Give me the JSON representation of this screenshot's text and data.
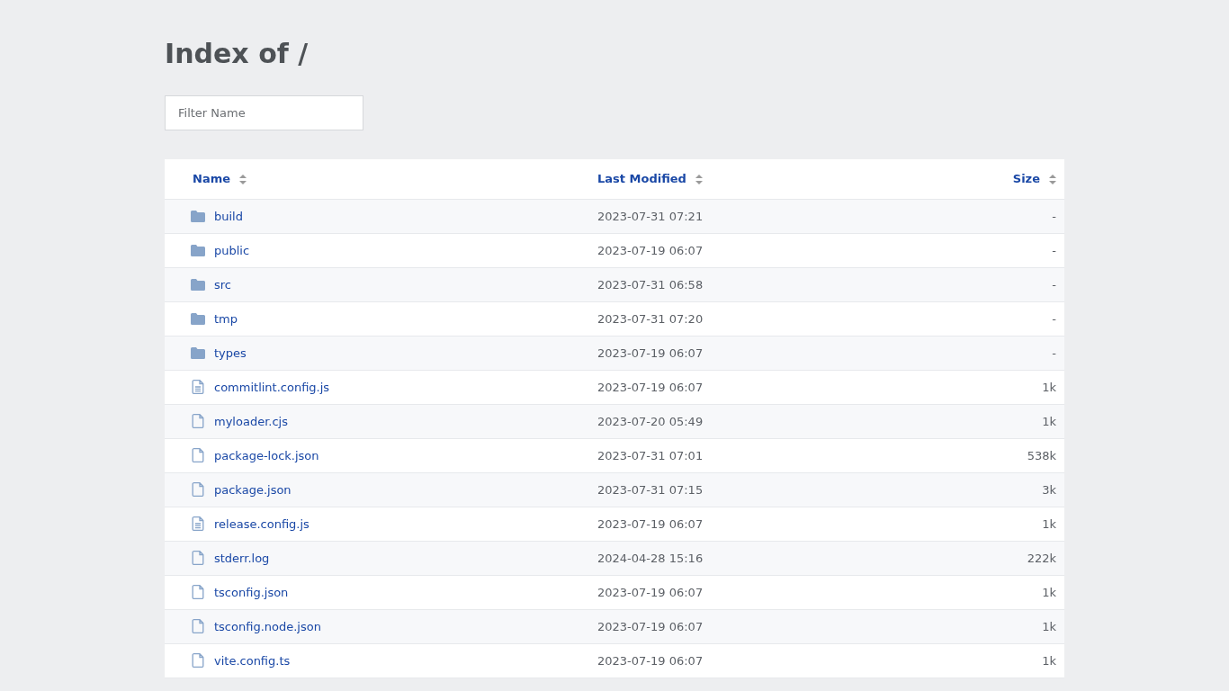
{
  "title": "Index of /",
  "filter": {
    "placeholder": "Filter Name"
  },
  "columns": [
    {
      "label": "Name"
    },
    {
      "label": "Last Modified"
    },
    {
      "label": "Size"
    }
  ],
  "rows": [
    {
      "kind": "folder",
      "name": "build",
      "modified": "2023-07-31 07:21",
      "size": "-"
    },
    {
      "kind": "folder",
      "name": "public",
      "modified": "2023-07-19 06:07",
      "size": "-"
    },
    {
      "kind": "folder",
      "name": "src",
      "modified": "2023-07-31 06:58",
      "size": "-"
    },
    {
      "kind": "folder",
      "name": "tmp",
      "modified": "2023-07-31 07:20",
      "size": "-"
    },
    {
      "kind": "folder",
      "name": "types",
      "modified": "2023-07-19 06:07",
      "size": "-"
    },
    {
      "kind": "text",
      "name": "commitlint.config.js",
      "modified": "2023-07-19 06:07",
      "size": "1k"
    },
    {
      "kind": "file",
      "name": "myloader.cjs",
      "modified": "2023-07-20 05:49",
      "size": "1k"
    },
    {
      "kind": "file",
      "name": "package-lock.json",
      "modified": "2023-07-31 07:01",
      "size": "538k"
    },
    {
      "kind": "file",
      "name": "package.json",
      "modified": "2023-07-31 07:15",
      "size": "3k"
    },
    {
      "kind": "text",
      "name": "release.config.js",
      "modified": "2023-07-19 06:07",
      "size": "1k"
    },
    {
      "kind": "file",
      "name": "stderr.log",
      "modified": "2024-04-28 15:16",
      "size": "222k"
    },
    {
      "kind": "file",
      "name": "tsconfig.json",
      "modified": "2023-07-19 06:07",
      "size": "1k"
    },
    {
      "kind": "file",
      "name": "tsconfig.node.json",
      "modified": "2023-07-19 06:07",
      "size": "1k"
    },
    {
      "kind": "file",
      "name": "vite.config.ts",
      "modified": "2023-07-19 06:07",
      "size": "1k"
    }
  ]
}
